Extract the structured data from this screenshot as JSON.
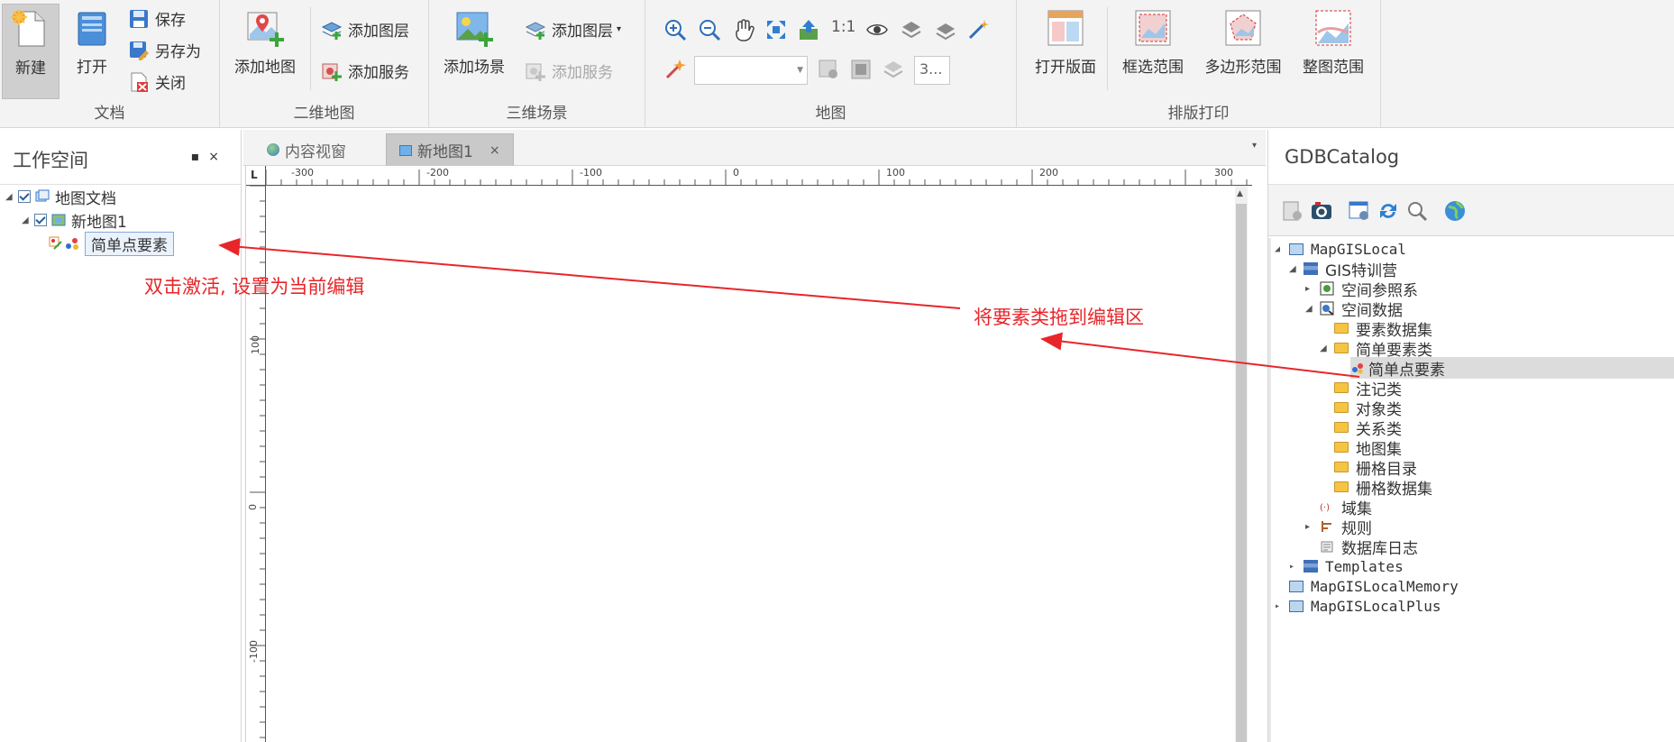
{
  "ribbon": {
    "doc_group": {
      "label": "文档",
      "new": "新建",
      "open": "打开",
      "save": "保存",
      "save_as": "另存为",
      "close": "关闭"
    },
    "map2d_group": {
      "label": "二维地图",
      "add_map": "添加地图",
      "add_layer": "添加图层",
      "add_service": "添加服务"
    },
    "scene3d_group": {
      "label": "三维场景",
      "add_scene": "添加场景",
      "add_layer": "添加图层",
      "add_service": "添加服务"
    },
    "map_group": {
      "label": "地图",
      "scale_1to1": "1:1",
      "small_combo": "3..."
    },
    "print_group": {
      "label": "排版打印",
      "open_layout": "打开版面",
      "rect_range": "框选范围",
      "polygon_range": "多边形范围",
      "full_range": "整图范围"
    }
  },
  "workspace": {
    "title": "工作空间",
    "pin": "▪",
    "close": "×",
    "tree": {
      "root": "地图文档",
      "map": "新地图1",
      "layer": "简单点要素"
    }
  },
  "tabs": {
    "content_view": "内容视窗",
    "new_map": "新地图1",
    "close": "×",
    "dropdown": "▾"
  },
  "ruler": {
    "h_labels": [
      "-300",
      "-200",
      "-100",
      "0",
      "100",
      "200",
      "300"
    ],
    "v_labels": [
      "100",
      "0",
      "-100"
    ],
    "corner": "L"
  },
  "catalog": {
    "title": "GDBCatalog",
    "tree": {
      "local": "MapGISLocal",
      "gis_camp": "GIS特训营",
      "spatial_ref": "空间参照系",
      "spatial_data": "空间数据",
      "feature_dataset": "要素数据集",
      "simple_feature_class": "简单要素类",
      "simple_point": "简单点要素",
      "annotation": "注记类",
      "object": "对象类",
      "relation": "关系类",
      "atlas": "地图集",
      "raster_catalog": "栅格目录",
      "raster_dataset": "栅格数据集",
      "domain": "域集",
      "rules": "规则",
      "db_log": "数据库日志",
      "templates": "Templates",
      "local_memory": "MapGISLocalMemory",
      "local_plus": "MapGISLocalPlus"
    }
  },
  "annotations": {
    "left": "双击激活, 设置为当前编辑",
    "right": "将要素类拖到编辑区"
  },
  "colors": {
    "annotation": "#e8262a",
    "ribbon_bg": "#f3f3f3",
    "active_tab": "#c9c9c9"
  }
}
